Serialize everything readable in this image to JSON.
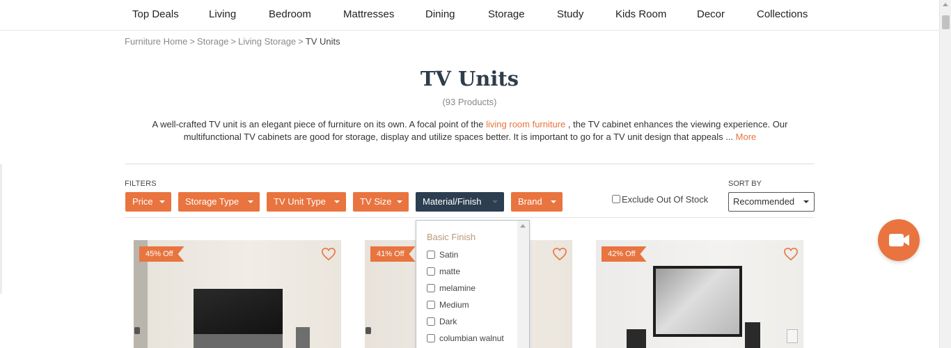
{
  "nav": {
    "items": [
      "Top Deals",
      "Living",
      "Bedroom",
      "Mattresses",
      "Dining",
      "Storage",
      "Study",
      "Kids Room",
      "Decor",
      "Collections"
    ]
  },
  "breadcrumb": {
    "items": [
      "Furniture Home",
      "Storage",
      "Living Storage"
    ],
    "current": "TV Units",
    "separator": ">"
  },
  "page": {
    "title": "TV Units",
    "count": "(93 Products)"
  },
  "description": {
    "part1": "A well-crafted TV unit is an elegant piece of furniture on its own. A focal point of the ",
    "link": "living room furniture",
    "part2": " , the TV cabinet enhances the viewing experience. Our multifunctional TV cabinets are good for storage, display and utilize spaces better. It is important to go for a TV unit design that appeals ... ",
    "more": "More"
  },
  "filters": {
    "label": "FILTERS",
    "buttons": [
      "Price",
      "Storage Type",
      "TV Unit Type",
      "TV Size",
      "Material/Finish",
      "Brand"
    ],
    "active": "Material/Finish",
    "exclude_out_of_stock": "Exclude Out Of Stock"
  },
  "sort": {
    "label": "SORT BY",
    "value": "Recommended"
  },
  "dropdown": {
    "group": "Basic Finish",
    "options": [
      "Satin",
      "matte",
      "melamine",
      "Medium",
      "Dark",
      "columbian walnut"
    ]
  },
  "products": [
    {
      "badge": "45% Off"
    },
    {
      "badge": "41% Off"
    },
    {
      "badge": "42% Off"
    }
  ],
  "colors": {
    "accent": "#e9743f",
    "active_filter": "#2c3e50",
    "title": "#2f3d4b"
  },
  "icons": {
    "wishlist": "heart-icon",
    "video": "video-camera-icon",
    "dropdown": "caret-down-icon"
  }
}
